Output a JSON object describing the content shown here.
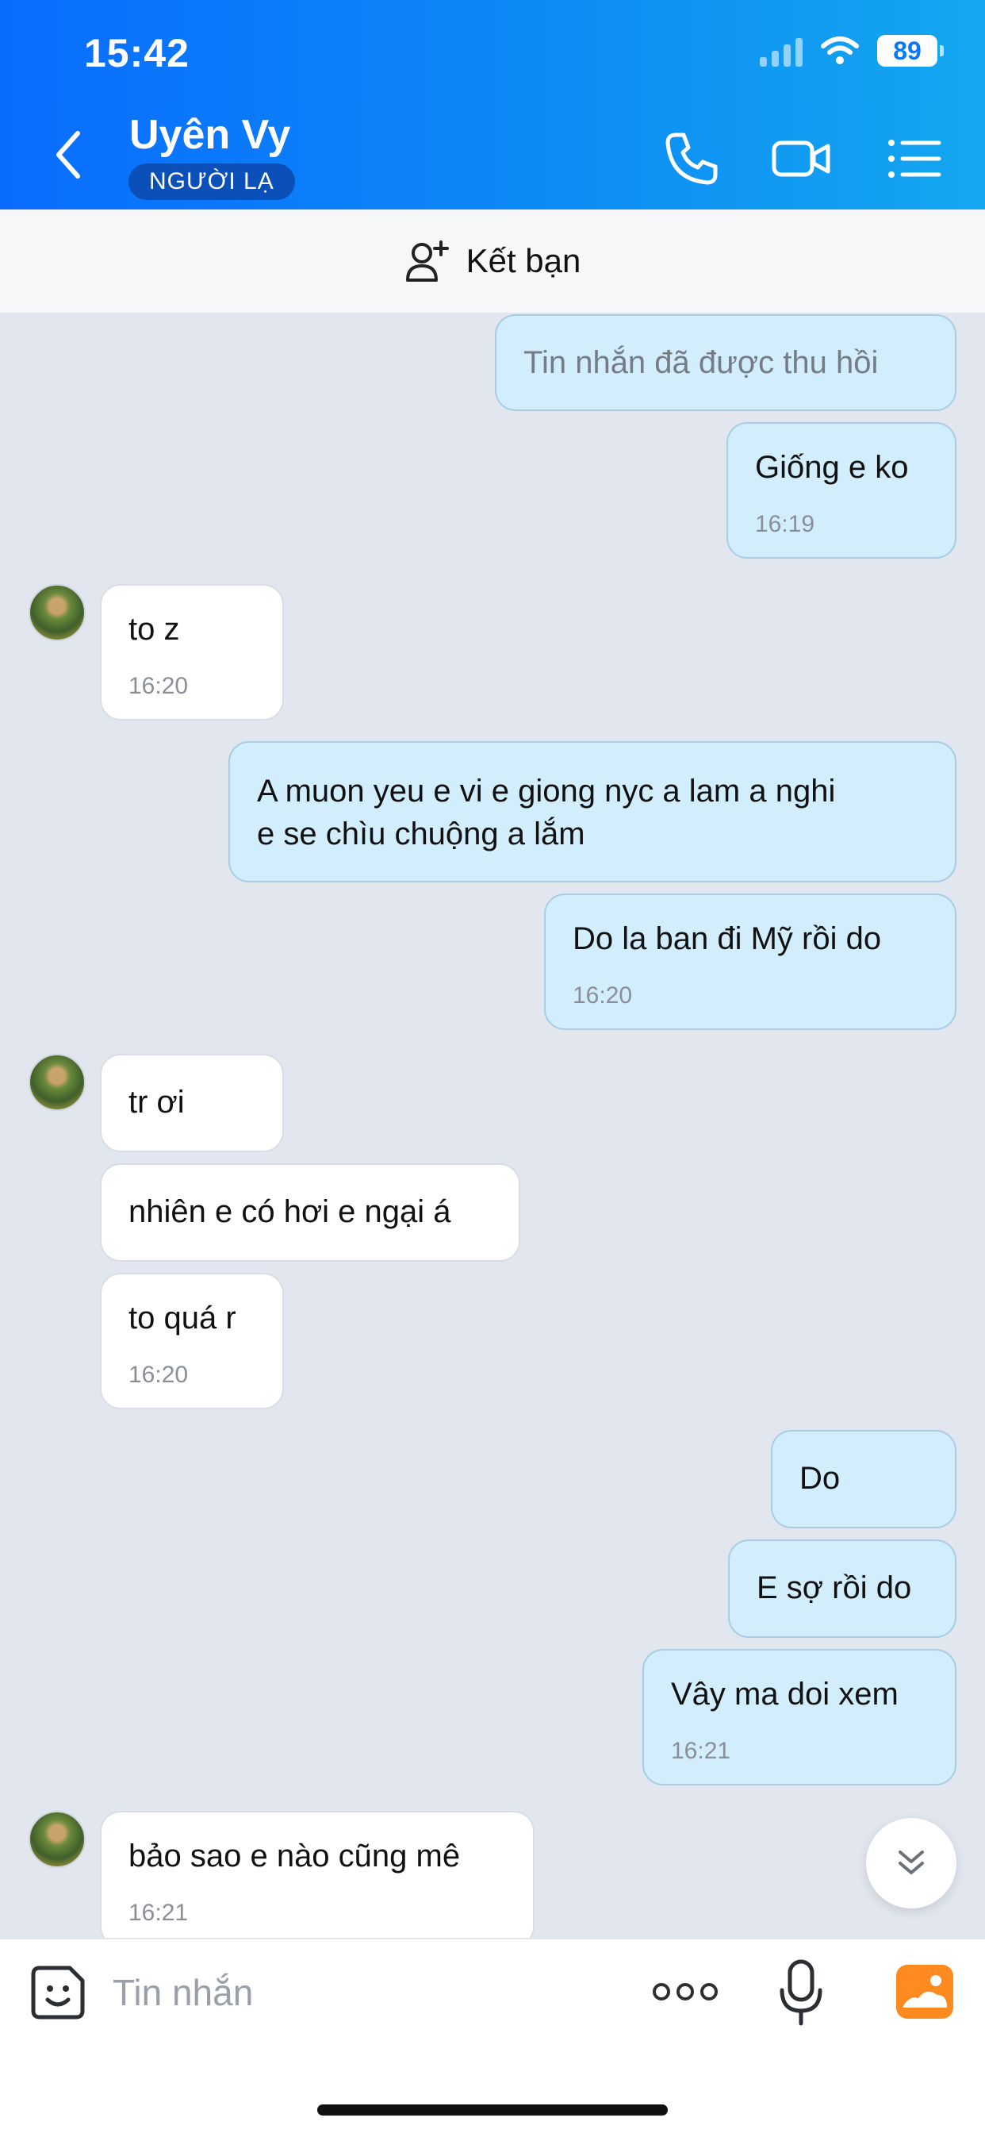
{
  "status_bar": {
    "time": "15:42",
    "battery": "89"
  },
  "header": {
    "name": "Uyên Vy",
    "badge": "NGƯỜI LẠ"
  },
  "friend_bar": {
    "label": "Kết bạn"
  },
  "messages": [
    {
      "text": "Tin nhắn đã được thu hồi"
    },
    {
      "text": "Giống e ko",
      "time": "16:19"
    },
    {
      "text": "to z",
      "time": "16:20"
    },
    {
      "line1": "A muon yeu e vi e giong nyc a lam a nghi",
      "line2": "e se chìu chuộng a lắm"
    },
    {
      "text": "Do la ban đi Mỹ rồi do",
      "time": "16:20"
    },
    {
      "text": "tr ơi"
    },
    {
      "text": "nhiên e có hơi e ngại á"
    },
    {
      "text": "to quá r",
      "time": "16:20"
    },
    {
      "text": "Do"
    },
    {
      "text": "E sợ rồi do"
    },
    {
      "text": "Vây ma doi xem",
      "time": "16:21"
    },
    {
      "text": "bảo sao e nào cũng mê",
      "time": "16:21"
    }
  ],
  "input": {
    "placeholder": "Tin nhắn"
  },
  "icons": {
    "back": "chevron-left-icon",
    "call": "phone-icon",
    "video": "video-camera-icon",
    "menu": "list-menu-icon",
    "add_friend": "add-user-icon",
    "sticker": "sticker-icon",
    "more": "more-dots-icon",
    "mic": "microphone-icon",
    "gallery": "image-gallery-icon",
    "scroll": "double-chevron-down-icon"
  },
  "colors": {
    "header": "#0a6cff",
    "outgoing_bubble": "#d2edfc",
    "incoming_bubble": "#ffffff",
    "gallery": "#ff8a1f"
  }
}
